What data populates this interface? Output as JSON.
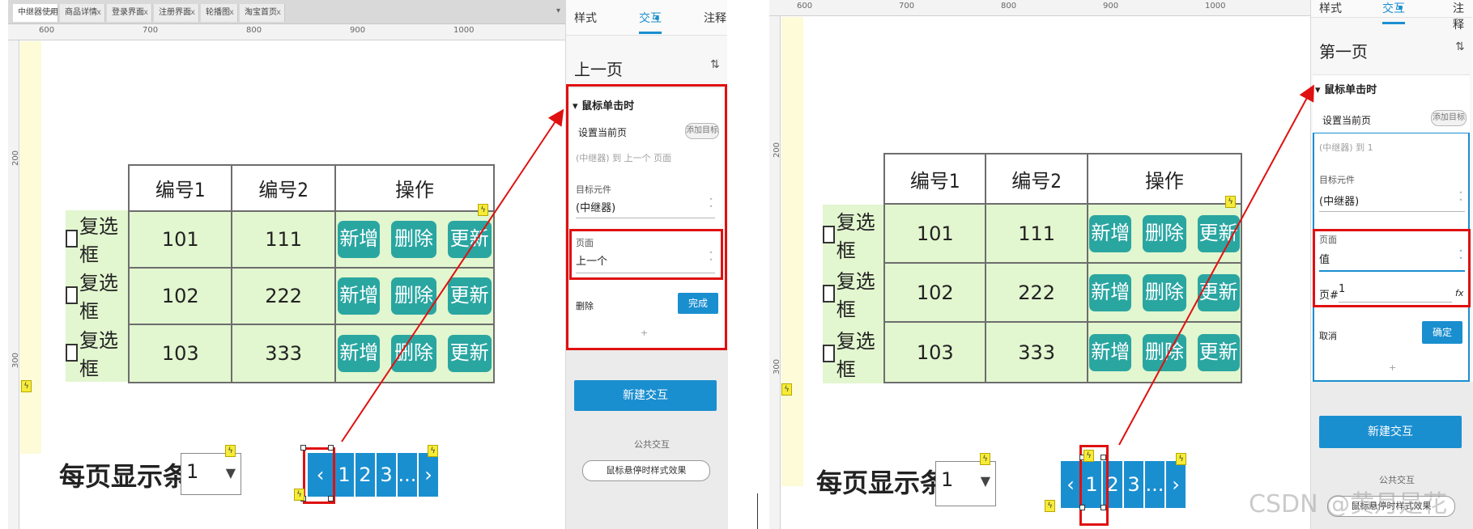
{
  "left": {
    "tabs": [
      "中继器使用",
      "商品详情",
      "登录界面",
      "注册界面",
      "轮播图",
      "淘宝首页"
    ],
    "tab_close": "x",
    "tab_dropdown": "▾",
    "ruler_h": [
      "600",
      "700",
      "800",
      "900",
      "1000"
    ],
    "ruler_v": [
      "200",
      "300"
    ],
    "table": {
      "headers": [
        "编号1",
        "编号2",
        "操作"
      ],
      "rows": [
        {
          "check": "复选框",
          "c1": "101",
          "c2": "111"
        },
        {
          "check": "复选框",
          "c1": "102",
          "c2": "222"
        },
        {
          "check": "复选框",
          "c1": "103",
          "c2": "333"
        }
      ],
      "ops": [
        "新增",
        "删除",
        "更新"
      ]
    },
    "per_page_label": "每页显示条数",
    "per_page_value": "1",
    "pager": [
      "‹",
      "1",
      "2",
      "3",
      "...",
      "›"
    ],
    "panel": {
      "tabs": [
        "样式",
        "交互",
        "注释"
      ],
      "element_title": "上一页",
      "event": "鼠标单击时",
      "action": "设置当前页",
      "add_target": "添加目标",
      "summary": "(中继器) 到 上一个 页面",
      "target_label": "目标元件",
      "target_value": "(中继器)",
      "page_label": "页面",
      "page_value": "上一个",
      "delete": "删除",
      "done": "完成",
      "plus": "+",
      "new_interaction": "新建交互",
      "public_label": "公共交互",
      "hover_effect": "鼠标悬停时样式效果"
    }
  },
  "right": {
    "ruler_h": [
      "600",
      "700",
      "800",
      "900",
      "1000"
    ],
    "ruler_v": [
      "200",
      "300"
    ],
    "table": {
      "headers": [
        "编号1",
        "编号2",
        "操作"
      ],
      "rows": [
        {
          "check": "复选框",
          "c1": "101",
          "c2": "111"
        },
        {
          "check": "复选框",
          "c1": "102",
          "c2": "222"
        },
        {
          "check": "复选框",
          "c1": "103",
          "c2": "333"
        }
      ],
      "ops": [
        "新增",
        "删除",
        "更新"
      ]
    },
    "per_page_label": "每页显示条数",
    "per_page_value": "1",
    "pager": [
      "‹",
      "1",
      "2",
      "3",
      "...",
      "›"
    ],
    "panel": {
      "tabs": [
        "样式",
        "交互",
        "注释"
      ],
      "element_title": "第一页",
      "event": "鼠标单击时",
      "action": "设置当前页",
      "add_target": "添加目标",
      "summary": "(中继器) 到 1",
      "target_label": "目标元件",
      "target_value": "(中继器)",
      "page_label": "页面",
      "page_value": "值",
      "page_no_label": "页#",
      "page_no_value": "1",
      "fx": "fx",
      "cancel": "取消",
      "confirm": "确定",
      "plus": "+",
      "new_interaction": "新建交互",
      "public_label": "公共交互",
      "hover_effect": "鼠标悬停时样式效果"
    }
  },
  "watermark": "CSDN @黄月是花",
  "colors": {
    "accent": "#1a8fd0",
    "op_button": "#2aa6a1",
    "row_fill": "#e2f6cf",
    "highlight": "#e01010"
  }
}
